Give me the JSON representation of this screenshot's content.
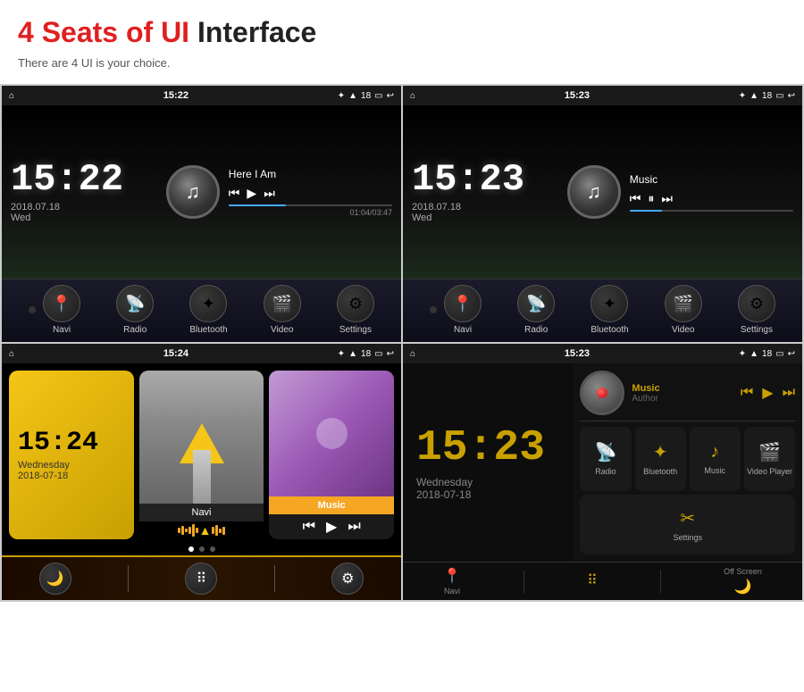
{
  "header": {
    "title_red": "4 Seats of UI",
    "title_white": " Interface",
    "subtitle": "There are 4 UI is your choice."
  },
  "ui1": {
    "time": "15:22",
    "date": "2018.07.18",
    "day": "Wed",
    "song": "Here I Am",
    "music_time": "01:04/03:47",
    "nav_items": [
      "Navi",
      "Radio",
      "Bluetooth",
      "Video",
      "Settings"
    ]
  },
  "ui2": {
    "time": "15:23",
    "date": "2018.07.18",
    "day": "Wed",
    "song": "Music",
    "nav_items": [
      "Navi",
      "Radio",
      "Bluetooth",
      "Video",
      "Settings"
    ]
  },
  "ui3": {
    "time": "15:24",
    "clock_display": "15:24",
    "date": "Wednesday",
    "date2": "2018-07-18",
    "card1_label": "Wednesday",
    "card1_date": "2018-07-18",
    "card2_label": "Navi",
    "card3_label": "Music",
    "page_dots": 3,
    "active_dot": 1
  },
  "ui4": {
    "time": "15:23",
    "clock_display": "15:23",
    "date": "Wednesday",
    "date2": "2018-07-18",
    "music_title": "Music",
    "music_author": "Author",
    "icons": [
      {
        "label": "Radio",
        "symbol": "📡"
      },
      {
        "label": "Bluetooth",
        "symbol": "✦"
      },
      {
        "label": "Music",
        "symbol": "♪"
      },
      {
        "label": "Video Player",
        "symbol": "🎬"
      },
      {
        "label": "Settings",
        "symbol": "✂"
      }
    ],
    "bottom": [
      {
        "label": "Navi",
        "symbol": "📍"
      },
      {
        "label": "",
        "symbol": "⠿"
      },
      {
        "label": "Off Screen",
        "symbol": ""
      }
    ]
  },
  "nav_icons": {
    "navi_sym": "📍",
    "radio_sym": "📡",
    "bt_sym": "✦",
    "video_sym": "🎬",
    "settings_sym": "⚙"
  }
}
